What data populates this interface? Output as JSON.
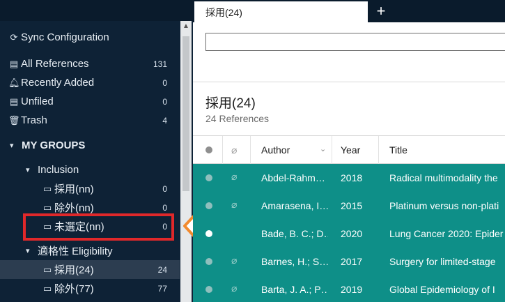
{
  "sidebar": {
    "sync_label": "Sync Configuration",
    "library": [
      {
        "label": "All References",
        "count": "131",
        "icon": "clipboard-icon"
      },
      {
        "label": "Recently Added",
        "count": "0",
        "icon": "bell-icon"
      },
      {
        "label": "Unfiled",
        "count": "0",
        "icon": "clipboard-icon"
      },
      {
        "label": "Trash",
        "count": "4",
        "icon": "trash-icon"
      }
    ],
    "groups_header": "MY GROUPS",
    "group_inclusion": {
      "label": "Inclusion",
      "children": [
        {
          "label": "採用(nn)",
          "count": "0"
        },
        {
          "label": "除外(nn)",
          "count": "0"
        },
        {
          "label": "未選定(nn)",
          "count": "0"
        }
      ]
    },
    "group_eligibility": {
      "label": "適格性 Eligibility",
      "children": [
        {
          "label": "採用(24)",
          "count": "24"
        },
        {
          "label": "除外(77)",
          "count": "77"
        }
      ]
    }
  },
  "tabs": {
    "active_label": "採用(24)",
    "add_label": "+"
  },
  "main": {
    "search_value": "",
    "collection_title": "採用(24)",
    "reference_count": "24 References",
    "columns": {
      "author": "Author",
      "year": "Year",
      "title": "Title"
    },
    "rows": [
      {
        "author": "Abdel-Rahm…",
        "year": "2018",
        "title": "Radical multimodality the",
        "read": false
      },
      {
        "author": "Amarasena, I…",
        "year": "2015",
        "title": "Platinum versus non-plati",
        "read": false
      },
      {
        "author": "Bade, B. C.; D…",
        "year": "2020",
        "title": "Lung Cancer 2020: Epider",
        "read": true
      },
      {
        "author": "Barnes, H.; S…",
        "year": "2017",
        "title": "Surgery for limited-stage",
        "read": false
      },
      {
        "author": "Barta, J. A.; P…",
        "year": "2019",
        "title": "Global Epidemiology of I",
        "read": false
      }
    ]
  },
  "colors": {
    "sidebar_bg": "#0e2236",
    "selected_row": "#0e8f88",
    "highlight_box": "#e0282a",
    "arrow": "#f28a2e"
  }
}
